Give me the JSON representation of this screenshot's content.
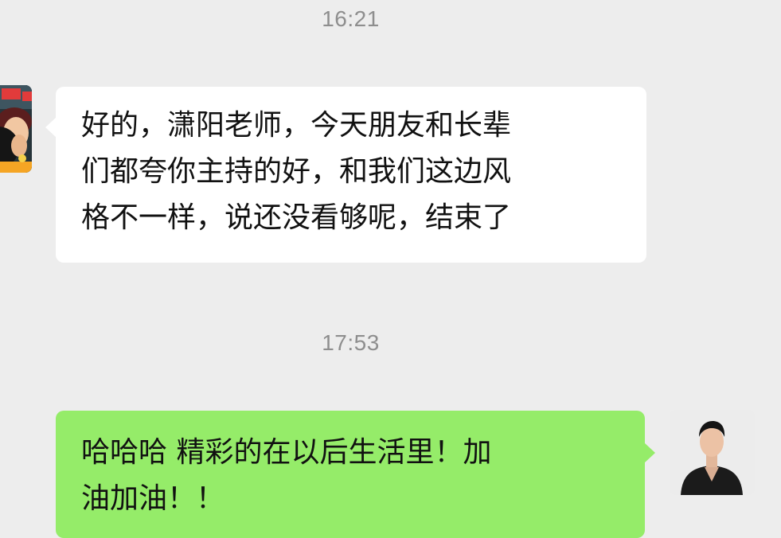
{
  "chat": {
    "messages": [
      {
        "timestamp": "16:21",
        "sender": "incoming",
        "avatar_icon": "cartoon-avatar-icon",
        "lines": [
          "好的，潇阳老师，今天朋友和长辈",
          "们都夸你主持的好，和我们这边风",
          "格不一样，说还没看够呢，结束了"
        ]
      },
      {
        "timestamp": "17:53",
        "sender": "outgoing",
        "avatar_icon": "man-portrait-avatar-icon",
        "lines": [
          "哈哈哈 精彩的在以后生活里！加",
          "油加油！！"
        ]
      }
    ]
  },
  "colors": {
    "background": "#ededed",
    "incoming_bubble": "#ffffff",
    "outgoing_bubble": "#95ec69",
    "timestamp_text": "#8e8e8e"
  }
}
